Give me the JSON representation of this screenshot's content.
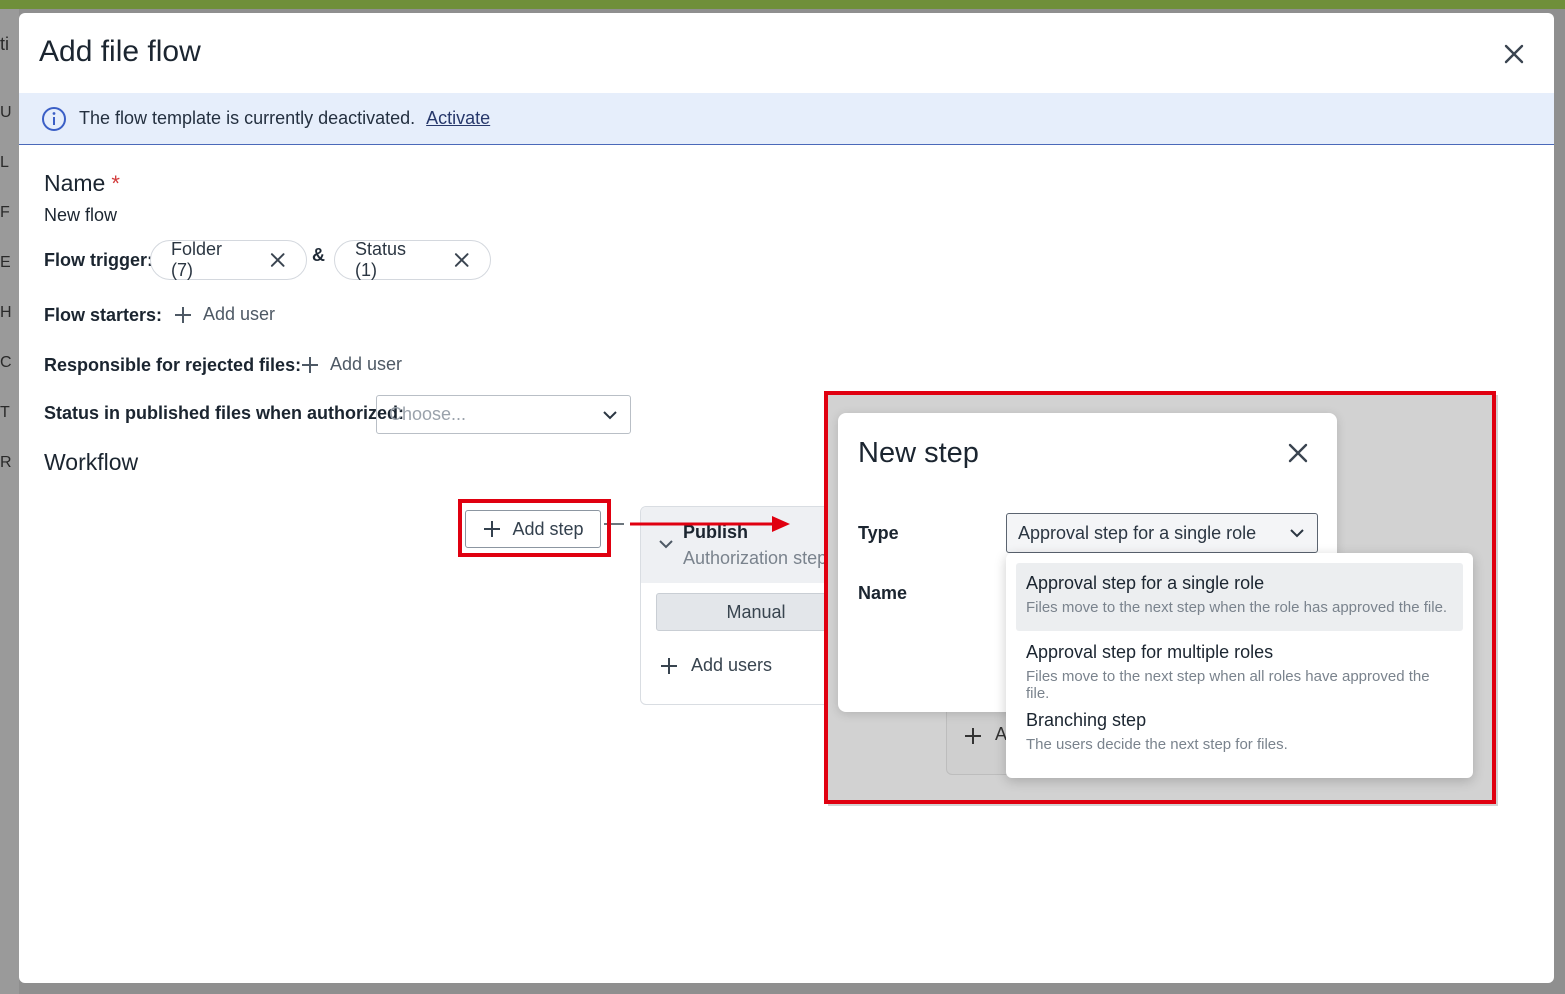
{
  "backdrop": {
    "side_fragments": [
      "ti",
      "U",
      "L",
      "F",
      "E",
      "H",
      "C",
      "T",
      "R"
    ]
  },
  "modal": {
    "title": "Add file flow",
    "banner": {
      "text": "The flow template is currently deactivated.",
      "link": "Activate"
    },
    "name": {
      "label": "Name",
      "required_mark": "*",
      "value": "New flow"
    },
    "flow_trigger": {
      "label": "Flow trigger:",
      "chips": [
        "Folder (7)",
        "Status (1)"
      ],
      "joiner": "&"
    },
    "flow_starters": {
      "label": "Flow starters:",
      "add_label": "Add user"
    },
    "rejected": {
      "label": "Responsible for rejected files:",
      "add_label": "Add user"
    },
    "status_published": {
      "label": "Status in published files when authorized:",
      "placeholder": "Choose..."
    },
    "workflow": {
      "label": "Workflow",
      "add_step_label": "Add step",
      "step": {
        "title": "Publish",
        "subtitle": "Authorization step",
        "mode": "Manual",
        "add_users": "Add users"
      }
    }
  },
  "new_step_dialog": {
    "title": "New step",
    "type_label": "Type",
    "name_label": "Name",
    "type_value": "Approval step for a single role",
    "options": [
      {
        "title": "Approval step for a single role",
        "desc": "Files move to the next step when the role has approved the file.",
        "selected": true
      },
      {
        "title": "Approval step for multiple roles",
        "desc": "Files move to the next step when all roles have approved the file.",
        "selected": false
      },
      {
        "title": "Branching step",
        "desc": "The users decide the next step for files.",
        "selected": false
      }
    ],
    "bg_card_fragment": "A"
  },
  "colors": {
    "highlight_red": "#e00010",
    "banner_bg": "#e6eefb",
    "required_red": "#d23a3a"
  }
}
